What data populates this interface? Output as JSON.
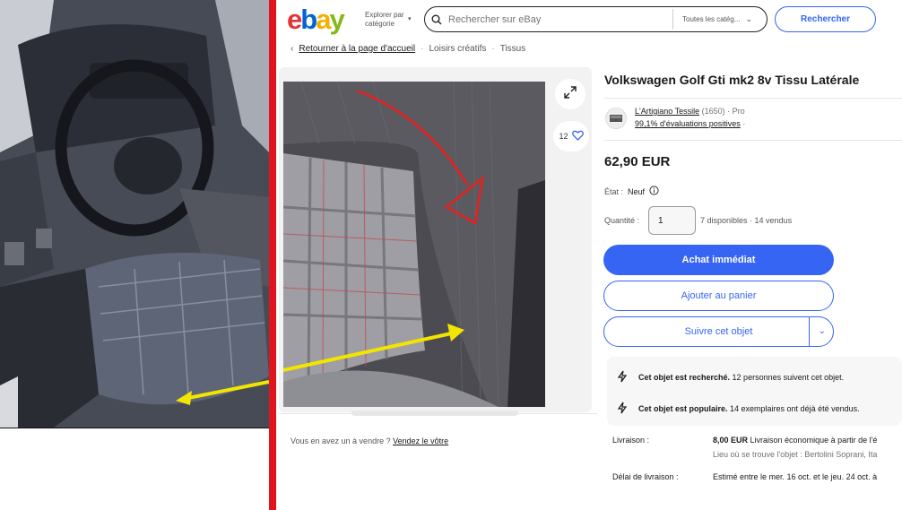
{
  "header": {
    "logo": [
      "e",
      "b",
      "a",
      "y"
    ],
    "explore": [
      "Explorer par",
      "catégorie"
    ],
    "search_placeholder": "Rechercher sur eBay",
    "category_select": "Toutes les catég...",
    "search_button": "Rechercher"
  },
  "breadcrumb": {
    "back": "Retourner à la page d'accueil",
    "items": [
      "Loisirs créatifs",
      "Tissus"
    ]
  },
  "gallery": {
    "watch_count": "12"
  },
  "sell": {
    "text": "Vous en avez un à vendre ?",
    "link": "Vendez le vôtre"
  },
  "item": {
    "title": "Volkswagen Golf Gti mk2 8v Tissu Latérale",
    "seller_name": "L'Artigiano Tessile",
    "seller_count": "(1650)",
    "seller_type": "· Pro",
    "feedback": "99,1% d'évaluations positives",
    "feedback_dot": "·",
    "price": "62,90 EUR",
    "condition_label": "État :",
    "condition_value": "Neuf",
    "quantity_label": "Quantité :",
    "quantity_value": "1",
    "availability": "7 disponibles · 14 vendus"
  },
  "buttons": {
    "buy": "Achat immédiat",
    "cart": "Ajouter au panier",
    "watch": "Suivre cet objet"
  },
  "promo": [
    {
      "bold": "Cet objet est recherché.",
      "text": " 12 personnes suivent cet objet."
    },
    {
      "bold": "Cet objet est populaire.",
      "text": " 14 exemplaires ont déjà été vendus."
    }
  ],
  "shipping": {
    "delivery_label": "Livraison :",
    "delivery_price": "8,00 EUR",
    "delivery_text": " Livraison économique à partir de l'é",
    "location": "Lieu où se trouve l'objet : Bertolini Soprani, Ita",
    "delay_label": "Délai de livraison :",
    "delay_text": "Estimé entre le mer. 16 oct. et le jeu. 24 oct. à"
  },
  "colors": {
    "brand_blue": "#3665f3",
    "divider_red": "#e0141e",
    "annotation_red": "#e8201e",
    "annotation_yellow": "#f2e500"
  }
}
